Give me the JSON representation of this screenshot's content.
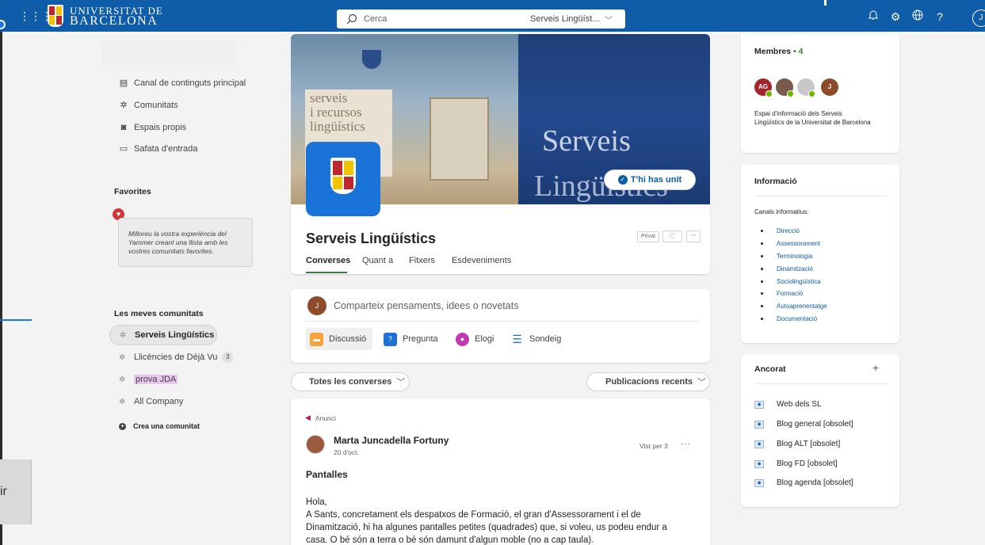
{
  "header": {
    "logo_line1": "UNIVERSITAT DE",
    "logo_line2": "BARCELONA",
    "search_placeholder": "Cerca",
    "search_scope": "Serveis Lingüíst...",
    "avatar_initial": "J"
  },
  "nav": {
    "items": [
      {
        "label": "Canal de continguts principal",
        "icon": "feed-icon"
      },
      {
        "label": "Comunitats",
        "icon": "communities-icon"
      },
      {
        "label": "Espais propis",
        "icon": "storyline-icon"
      },
      {
        "label": "Safata d'entrada",
        "icon": "inbox-icon"
      }
    ],
    "favorites_title": "Favorites",
    "favorites_hint": "Milloreu la vostra experiència del Yammer creant una llista amb les vostres comunitats favorites.",
    "my_communities_title": "Les meves comunitats",
    "communities": [
      {
        "label": "Serveis Lingüístics",
        "selected": true
      },
      {
        "label": "Llicències de Déjà Vu",
        "badge": "3"
      },
      {
        "label": "prova JDA",
        "highlight": true
      },
      {
        "label": "All Company"
      }
    ],
    "create_label": "Crea una comunitat"
  },
  "left_edge_text": "ir",
  "group": {
    "hero_left_text": "serveis\ni recursos\nlingüístics",
    "hero_right_line1": "Serveis",
    "hero_right_line2": "Lingüístics",
    "join_label": "T'hi has unit",
    "name": "Serveis Lingüístics",
    "privacy": "Privat",
    "tabs": [
      "Converses",
      "Quant a",
      "Fitxers",
      "Esdeveniments"
    ],
    "active_tab": "Converses"
  },
  "composer": {
    "avatar_initial": "J",
    "placeholder": "Comparteix pensaments, idees o novetats",
    "types": [
      {
        "label": "Discussió",
        "color": "#f7a13a"
      },
      {
        "label": "Pregunta",
        "color": "#1e6fd9"
      },
      {
        "label": "Elogi",
        "color": "#c239b3"
      },
      {
        "label": "Sondeig",
        "color": "#1e6fd9"
      }
    ]
  },
  "filters": {
    "conversations": "Totes les converses",
    "sort": "Publicacions recents"
  },
  "post": {
    "tag": "Anunci",
    "author": "Marta Juncadella Fortuny",
    "date": "20 d'oct.",
    "seen": "Vist per 3",
    "title": "Pantalles",
    "body": [
      "Hola,",
      "A Sants, concretament els despatxos de Formació, el gran d'Assessorament i el de",
      "Dinamització, hi ha algunes pantalles petites (quadrades) que, si voleu, us podeu endur a",
      "casa. O bé són a terra o bé són damunt d'algun moble (no a cap taula)."
    ]
  },
  "members": {
    "title": "Membres",
    "count": "4",
    "avatars": [
      {
        "initials": "AG",
        "color": "#a4262c"
      },
      {
        "initials": "",
        "color": "#7a5a4a"
      },
      {
        "initials": "",
        "color": "#b0b0b0"
      },
      {
        "initials": "J",
        "color": "#8e4b2b"
      }
    ],
    "description": "Espai d'informació dels Serveis Lingüístics de la Universitat de Barcelona"
  },
  "info": {
    "title": "Informació",
    "subtitle": "Canals informatius:",
    "links": [
      "Direcció",
      "Assessorament",
      "Terminologia",
      "Dinamització",
      "Sociolingüística",
      "Formació",
      "Autoaprenentatge",
      "Documentació"
    ]
  },
  "pinned": {
    "title": "Ancorat",
    "items": [
      "Web dels SL",
      "Blog general [obsolet]",
      "Blog ALT [obsolet]",
      "Blog FD [obsolet]",
      "Blog agenda [obsolet]"
    ]
  }
}
